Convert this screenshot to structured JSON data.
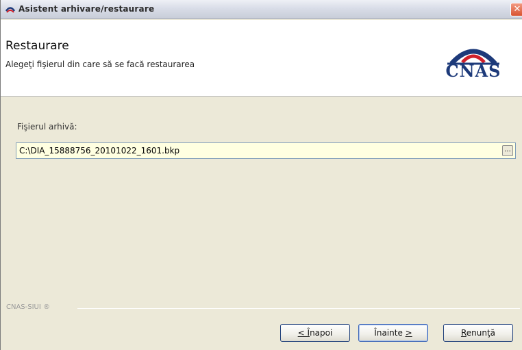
{
  "window": {
    "title": "Asistent arhivare/restaurare",
    "close_symbol": "✕"
  },
  "header": {
    "title": "Restaurare",
    "subtitle": "Alegeţi fişierul din care să se facă restaurarea",
    "logo_text": "CNAS"
  },
  "form": {
    "file_label": "Fişierul arhivă:",
    "file_value": "C:\\DIA_15888756_20101022_1601.bkp",
    "browse_label": "..."
  },
  "footer": {
    "brand": "CNAS-SIUI ®"
  },
  "buttons": {
    "back_mnemonic": "Î",
    "back_rest": "napoi",
    "back_prefix": "< ",
    "next_text": "Înainte ",
    "next_suffix": ">",
    "cancel_mnemonic": "R",
    "cancel_rest": "enunţă"
  },
  "colors": {
    "input_background": "#ffffe1",
    "logo_blue": "#1d3a7a",
    "logo_red": "#d0202a"
  },
  "icons": {
    "title_icon": "cnas-app-icon",
    "logo": "cnas-logo"
  }
}
